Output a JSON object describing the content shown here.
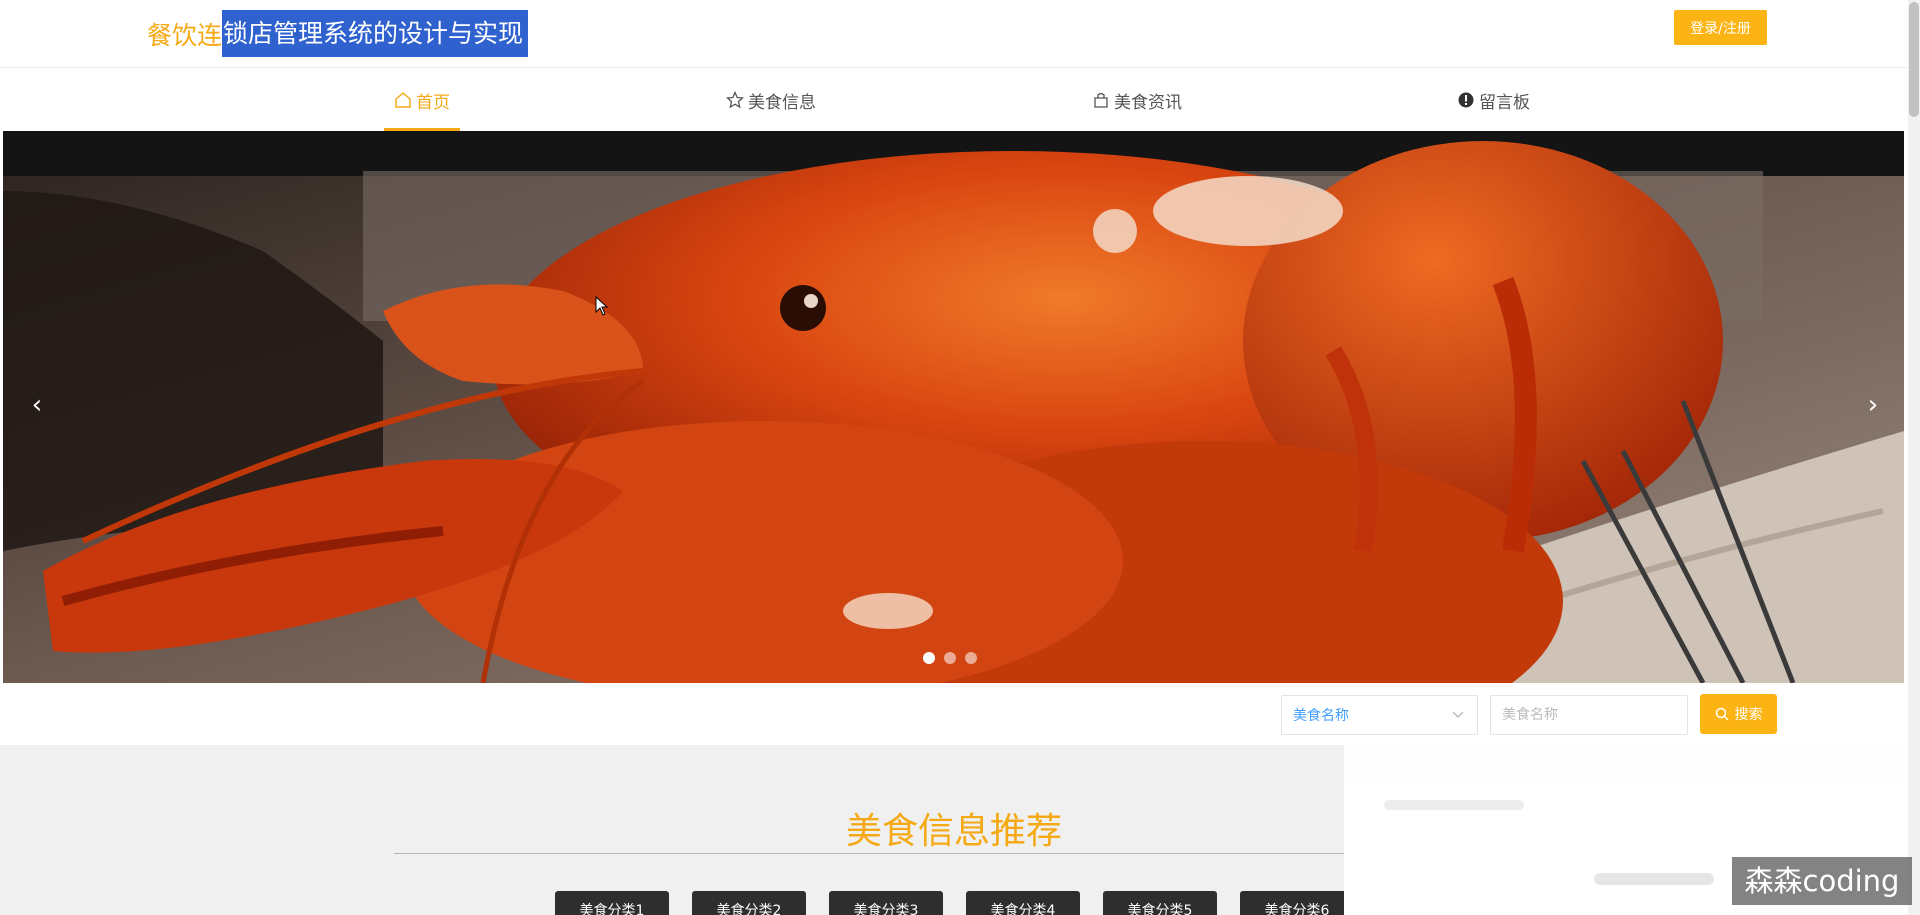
{
  "header": {
    "title_part1": "餐饮连",
    "title_part2": "锁店管理系统的设计与实现",
    "login_label": "登录/注册"
  },
  "nav": {
    "items": [
      {
        "label": "首页",
        "icon": "home-icon",
        "active": true
      },
      {
        "label": "美食信息",
        "icon": "star-icon",
        "active": false
      },
      {
        "label": "美食资讯",
        "icon": "bag-icon",
        "active": false
      },
      {
        "label": "留言板",
        "icon": "info-circle-icon",
        "active": false
      }
    ]
  },
  "banner": {
    "image": "red lobster on wooden board",
    "slide_count": 3,
    "active_slide": 1,
    "prev_arrow": "‹",
    "next_arrow": "›"
  },
  "search": {
    "select_value": "美食名称",
    "input_placeholder": "美食名称",
    "button_label": "搜索"
  },
  "section": {
    "title": "美食信息推荐",
    "categories": [
      "美食分类1",
      "美食分类2",
      "美食分类3",
      "美食分类4",
      "美食分类5",
      "美食分类6"
    ]
  },
  "watermark": "森森coding",
  "colors": {
    "accent": "#f5a914",
    "button": "#fcb414",
    "selection": "#2f62cf",
    "category_bg": "#2e2e2e"
  }
}
